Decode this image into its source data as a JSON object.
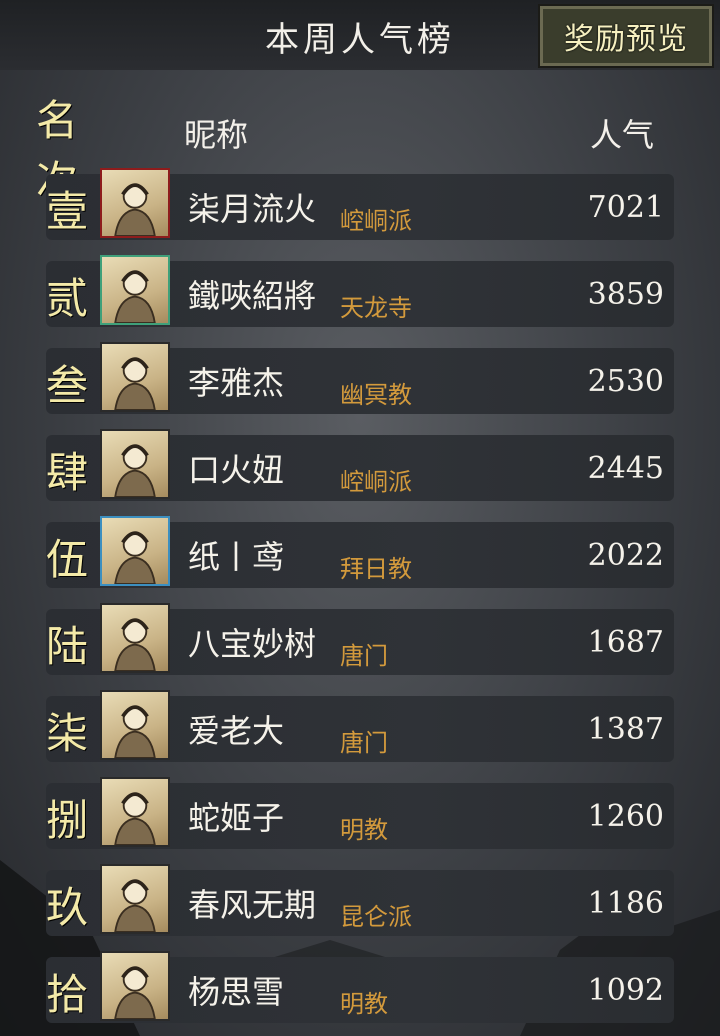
{
  "header": {
    "title": "本周人气榜",
    "reward_button": "奖励预览"
  },
  "columns": {
    "rank": "名次",
    "name": "昵称",
    "popularity": "人气"
  },
  "rows": [
    {
      "rank": "壹",
      "name": "柒月流火",
      "sect": "崆峒派",
      "score": "7021",
      "avatar": "portrait-straw-hat"
    },
    {
      "rank": "贰",
      "name": "鐵唊紹將",
      "sect": "天龙寺",
      "score": "3859",
      "avatar": "portrait-flower-hair"
    },
    {
      "rank": "叁",
      "name": "李雅杰",
      "sect": "幽冥教",
      "score": "2530",
      "avatar": "portrait-masked"
    },
    {
      "rank": "肆",
      "name": "口火妞",
      "sect": "崆峒派",
      "score": "2445",
      "avatar": "portrait-long-hair"
    },
    {
      "rank": "伍",
      "name": "纸丨鸢",
      "sect": "拜日教",
      "score": "2022",
      "avatar": "portrait-swordswoman"
    },
    {
      "rank": "陆",
      "name": "八宝妙树",
      "sect": "唐门",
      "score": "1687",
      "avatar": "portrait-young"
    },
    {
      "rank": "柒",
      "name": "爱老大",
      "sect": "唐门",
      "score": "1387",
      "avatar": "portrait-man"
    },
    {
      "rank": "捌",
      "name": "蛇姬子",
      "sect": "明教",
      "score": "1260",
      "avatar": "portrait-scholar"
    },
    {
      "rank": "玖",
      "name": "春风无期",
      "sect": "昆仑派",
      "score": "1186",
      "avatar": "portrait-wanderer"
    },
    {
      "rank": "拾",
      "name": "杨思雪",
      "sect": "明教",
      "score": "1092",
      "avatar": "portrait-girl"
    }
  ]
}
